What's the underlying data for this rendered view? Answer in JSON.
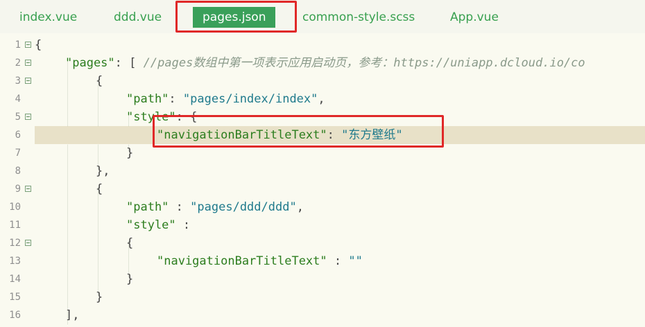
{
  "tabs": [
    {
      "label": "index.vue",
      "active": false
    },
    {
      "label": "ddd.vue",
      "active": false
    },
    {
      "label": "pages.json",
      "active": true
    },
    {
      "label": "common-style.scss",
      "active": false
    },
    {
      "label": "App.vue",
      "active": false
    }
  ],
  "editor": {
    "lines": [
      {
        "num": "1"
      },
      {
        "num": "2"
      },
      {
        "num": "3"
      },
      {
        "num": "4"
      },
      {
        "num": "5"
      },
      {
        "num": "6"
      },
      {
        "num": "7"
      },
      {
        "num": "8"
      },
      {
        "num": "9"
      },
      {
        "num": "10"
      },
      {
        "num": "11"
      },
      {
        "num": "12"
      },
      {
        "num": "13"
      },
      {
        "num": "14"
      },
      {
        "num": "15"
      },
      {
        "num": "16"
      }
    ],
    "tokens": {
      "brace_open": "{",
      "brace_close": "}",
      "pages_key": "\"pages\"",
      "colon": ":",
      "bracket_open": "[",
      "comment": "//pages数组中第一项表示应用启动页，参考：https://uniapp.dcloud.io/co",
      "path_key": "\"path\"",
      "path1_val": "\"pages/index/index\"",
      "comma": ",",
      "style_key": "\"style\"",
      "nav_key": "\"navigationBarTitleText\"",
      "nav1_val": "\"东方壁纸\"",
      "brace_close_comma": "},",
      "path2_val": "\"pages/ddd/ddd\"",
      "nav2_val": "\"\"",
      "bracket_close_comma": "],"
    }
  },
  "colors": {
    "tab_text": "#38a04f",
    "tab_active_bg": "#3aa05a",
    "highlight_box": "#e02828",
    "current_line_bg": "#e8e1c8",
    "key_color": "#2c7d1e",
    "string_color": "#1f7a8c"
  }
}
